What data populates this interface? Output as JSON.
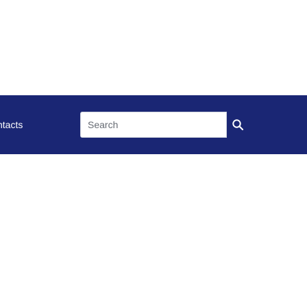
{
  "navbar": {
    "background": "#1a2674",
    "link_label": "ntacts",
    "search": {
      "placeholder": "Search",
      "value": "",
      "button_icon": "search-icon"
    }
  }
}
